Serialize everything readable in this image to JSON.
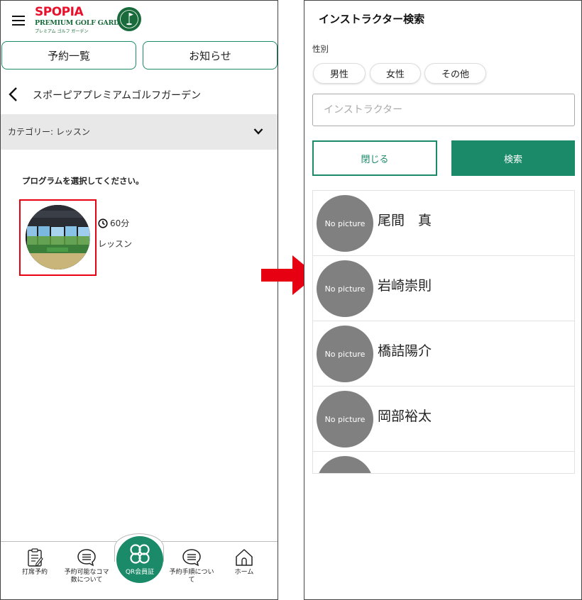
{
  "left": {
    "brand": {
      "name": "SPOPIA",
      "subtitle": "PREMIUM GOLF GARDEN",
      "kana": "プレミアム ゴルフ ガーデン"
    },
    "tabs": [
      {
        "label": "予約一覧"
      },
      {
        "label": "お知らせ"
      }
    ],
    "breadcrumb": {
      "title": "スポーピアプレミアムゴルフガーデン"
    },
    "category": {
      "label": "カテゴリー: レッスン"
    },
    "prompt": "プログラムを選択してください。",
    "program": {
      "duration": "60分",
      "name": "レッスン"
    },
    "bottom_nav": [
      {
        "label": "打席予約",
        "icon": "clipboard-icon"
      },
      {
        "label": "予約可能なコマ数について",
        "icon": "chat-icon"
      },
      {
        "label": "QR会員証",
        "icon": "qr-icon"
      },
      {
        "label": "予約手順について",
        "icon": "chat-icon"
      },
      {
        "label": "ホーム",
        "icon": "home-icon"
      }
    ]
  },
  "right": {
    "title": "インストラクター検索",
    "gender_label": "性別",
    "gender_options": [
      "男性",
      "女性",
      "その他"
    ],
    "search_input": {
      "placeholder": "インストラクター",
      "value": ""
    },
    "close_label": "閉じる",
    "search_label": "検索",
    "no_picture": "No picture",
    "instructors": [
      {
        "name": "尾間　真"
      },
      {
        "name": "岩崎崇則"
      },
      {
        "name": "橋詰陽介"
      },
      {
        "name": "岡部裕太"
      },
      {
        "name": ""
      }
    ]
  },
  "colors": {
    "accent": "#1a8a68",
    "brand_red": "#e8112d",
    "highlight_red": "#e60012",
    "avatar_gray": "#808080"
  }
}
